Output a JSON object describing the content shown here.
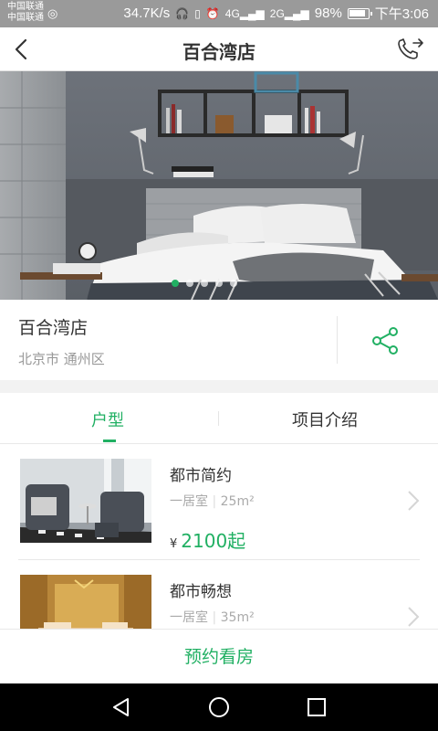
{
  "status_bar": {
    "carrier_1": "中国联通",
    "carrier_2": "中国联通",
    "net_speed": "34.7K/s",
    "net_4g": "4G",
    "net_2g": "2G",
    "battery": "98%",
    "time": "下午3:06",
    "icons": [
      "headphones-icon",
      "vibrate-icon",
      "alarm-icon",
      "signal-icon",
      "battery-icon"
    ]
  },
  "app_bar": {
    "title": "百合湾店",
    "back_icon": "chevron-left-icon",
    "phone_icon": "phone-forward-icon"
  },
  "hero": {
    "carousel_count": 5,
    "active_index": 0
  },
  "store": {
    "name": "百合湾店",
    "location": "北京市 通州区",
    "share_icon": "share-icon"
  },
  "tabs": [
    {
      "label": "户型",
      "active": true
    },
    {
      "label": "项目介绍",
      "active": false
    }
  ],
  "room_types": [
    {
      "name": "都市简约",
      "layout": "一居室",
      "area": "25m²",
      "currency": "¥",
      "price": "2100起"
    },
    {
      "name": "都市畅想",
      "layout": "一居室",
      "area": "35m²"
    }
  ],
  "cta": {
    "label": "预约看房"
  },
  "colors": {
    "accent": "#21b063",
    "text": "#333333",
    "muted": "#999999"
  }
}
